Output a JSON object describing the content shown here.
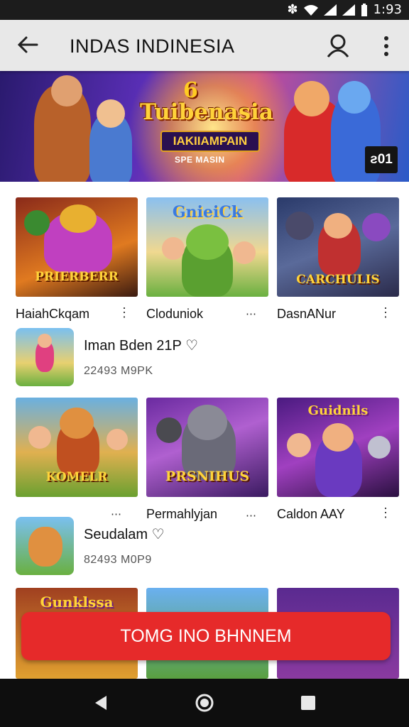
{
  "status": {
    "time": "1:93"
  },
  "appbar": {
    "title": "INDAS INDINESIA"
  },
  "banner": {
    "title_top": "6",
    "title": "Tuibenasia",
    "subtitle": "IAKIIAMPAIN",
    "small_text": "SPE MASIN",
    "corner_badge": "ƨ01"
  },
  "grid1": {
    "items": [
      {
        "caption": "PRIERBERR",
        "label": "HaiahCkqam"
      },
      {
        "caption": "GnieiCk",
        "label": "Cloduniok"
      },
      {
        "caption": "CARCHULIS",
        "label": "DasnANur"
      }
    ]
  },
  "list1": {
    "name": "Iman Bden 21P ♡",
    "meta": "22493 M9PK"
  },
  "grid2": {
    "items": [
      {
        "caption": "KOMELR",
        "label": ""
      },
      {
        "caption": "PRSNIHUS",
        "label": "Permahlyjan"
      },
      {
        "caption": "Guidnils",
        "label": "Caldon AAY"
      }
    ]
  },
  "list2": {
    "name": "Seudalam ♡",
    "meta": "82493 M0P9"
  },
  "grid3": {
    "items": [
      {
        "caption": "Gunklssa"
      },
      {
        "caption": ""
      },
      {
        "caption": ""
      }
    ]
  },
  "cta": {
    "label": "TOMG INO BHNNEM"
  },
  "colors": {
    "accent_red": "#e62a2a",
    "appbar_bg": "#e8e8e8"
  }
}
